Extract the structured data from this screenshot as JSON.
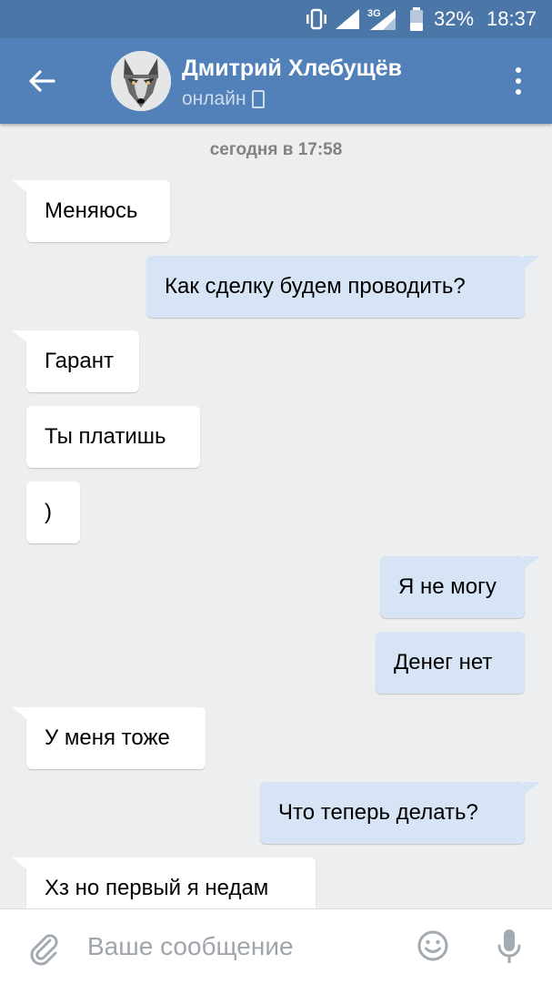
{
  "status_bar": {
    "network": "3G",
    "battery_percent": "32%",
    "time": "18:37",
    "icons": [
      "vibrate-icon",
      "signal-icon",
      "signal-3g-icon",
      "battery-icon"
    ]
  },
  "header": {
    "contact_name": "Дмитрий Хлебущёв",
    "status": "онлайн",
    "icons": [
      "back-arrow-icon",
      "wolf-avatar",
      "mobile-phone-icon",
      "more-vert-icon"
    ]
  },
  "chat": {
    "date_separator": "сегодня в 17:58",
    "messages": [
      {
        "direction": "in",
        "text": "Меняюсь"
      },
      {
        "direction": "out",
        "text": "Как сделку будем проводить?"
      },
      {
        "direction": "in",
        "text": "Гарант"
      },
      {
        "direction": "in",
        "text": "Ты платишь"
      },
      {
        "direction": "in",
        "text": ")"
      },
      {
        "direction": "out",
        "text": "Я не могу"
      },
      {
        "direction": "out",
        "text": "Денег нет"
      },
      {
        "direction": "in",
        "text": "У меня тоже"
      },
      {
        "direction": "out",
        "text": "Что  теперь делать?"
      },
      {
        "direction": "in",
        "text": "Хз но первый я недам"
      }
    ]
  },
  "composer": {
    "placeholder": "Ваше сообщение",
    "value": "",
    "icons": [
      "paperclip-icon",
      "emoji-icon",
      "microphone-icon"
    ]
  },
  "colors": {
    "header_bg": "#5181b8",
    "status_bar_bg": "#4a76a8",
    "chat_bg": "#edeef0",
    "incoming_bubble": "#ffffff",
    "outgoing_bubble": "#d6e4f5"
  }
}
